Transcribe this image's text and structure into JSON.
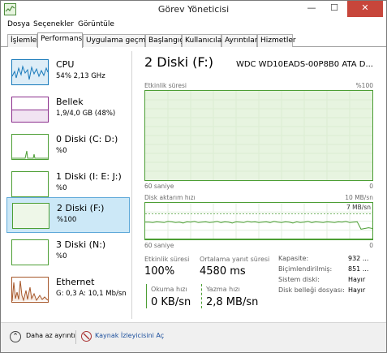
{
  "window": {
    "title": "Görev Yöneticisi",
    "minimize_glyph": "—",
    "maximize_glyph": "☐",
    "close_glyph": "✕"
  },
  "menu": [
    "Dosya",
    "Seçenekler",
    "Görüntüle"
  ],
  "tabs": [
    "İşlemler",
    "Performans",
    "Uygulama geçmişi",
    "Başlangıç",
    "Kullanıcılar",
    "Ayrıntılar",
    "Hizmetler"
  ],
  "active_tab": "Performans",
  "resources": [
    {
      "name": "CPU",
      "sub": "54% 2,13 GHz",
      "color": "#1779ba",
      "fill": "#ddedf7"
    },
    {
      "name": "Bellek",
      "sub": "1,9/4,0 GB (48%)",
      "color": "#8b2f8d",
      "fill": "#f1e3f2"
    },
    {
      "name": "0 Diski (C: D:)",
      "sub": "%0",
      "color": "#4c9e34",
      "fill": "#eef7e8"
    },
    {
      "name": "1 Diski (I: E: J:)",
      "sub": "%0",
      "color": "#4c9e34",
      "fill": "#eef7e8"
    },
    {
      "name": "2 Diski (F:)",
      "sub": "%100",
      "color": "#4c9e34",
      "fill": "#eef7e8"
    },
    {
      "name": "3 Diski (N:)",
      "sub": "%0",
      "color": "#4c9e34",
      "fill": "#eef7e8"
    },
    {
      "name": "Ethernet",
      "sub": "G: 0,3 A: 10,1 Mb/sn",
      "color": "#a6572a",
      "fill": "#f7ece4"
    }
  ],
  "selected_resource": 4,
  "detail": {
    "title": "2 Diski (F:)",
    "model": "WDC WD10EADS-00P8B0 ATA D...",
    "active_time_label": "Etkinlik süresi",
    "active_time_max": "%100",
    "active_time_xleft": "60 saniye",
    "active_time_xright": "0",
    "transfer_label": "Disk aktarım hızı",
    "transfer_max": "10 MB/sn",
    "transfer_marker": "7 MB/sn",
    "transfer_xleft": "60 saniye",
    "transfer_xright": "0",
    "active_time_level": 1.0,
    "transfer_series": [
      4.7,
      4.7,
      4.6,
      4.8,
      4.7,
      4.6,
      4.9,
      4.8,
      4.6,
      4.7,
      4.5,
      4.8,
      4.7,
      4.9,
      4.6,
      4.7,
      4.8,
      4.6,
      4.7,
      4.9,
      4.6,
      4.8,
      4.7,
      4.5,
      4.8,
      4.7,
      4.6,
      4.9,
      4.7,
      4.8,
      4.6,
      4.7,
      4.8,
      4.6,
      4.9,
      4.7,
      4.6,
      4.8,
      4.7,
      4.5,
      4.8,
      4.6,
      4.7,
      4.9,
      4.6,
      4.8,
      4.7,
      4.6,
      4.8,
      4.7,
      4.6,
      4.8,
      4.7,
      4.9,
      4.6,
      4.7,
      4.8,
      2.8,
      3.0,
      3.2,
      3.0
    ],
    "transfer_max_value": 10,
    "transfer_marker_value": 7,
    "stats": {
      "active_time_label": "Etkinlik süresi",
      "active_time_value": "100%",
      "response_label": "Ortalama yanıt süresi",
      "response_value": "4580 ms",
      "read_label": "Okuma hızı",
      "read_value": "0 KB/sn",
      "write_label": "Yazma hızı",
      "write_value": "2,8 MB/sn"
    },
    "properties": [
      {
        "label": "Kapasite:",
        "value": "932 ..."
      },
      {
        "label": "Biçimlendirilmiş:",
        "value": "851 ..."
      },
      {
        "label": "Sistem diski:",
        "value": "Hayır"
      },
      {
        "label": "Disk belleği dosyası:",
        "value": "Hayır"
      }
    ]
  },
  "footer": {
    "fewer_details": "Daha az ayrıntı",
    "fewer_icon": "chevron-up-icon",
    "open_monitor": "Kaynak İzleyicisini Aç",
    "monitor_icon": "resource-monitor-icon"
  }
}
